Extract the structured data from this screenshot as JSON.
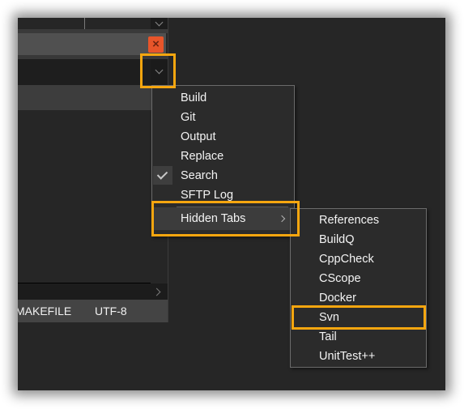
{
  "accent_color": "#f6a60f",
  "panel": {
    "close_icon": "×",
    "close_icon_name": "close-icon",
    "dropdown_icon_name": "chevron-down-icon",
    "status": {
      "file_type": "MAKEFILE",
      "encoding": "UTF-8"
    }
  },
  "menu": {
    "items": [
      {
        "label": "Build",
        "checked": false
      },
      {
        "label": "Git",
        "checked": false
      },
      {
        "label": "Output",
        "checked": false
      },
      {
        "label": "Replace",
        "checked": false
      },
      {
        "label": "Search",
        "checked": true
      },
      {
        "label": "SFTP Log",
        "checked": false
      },
      {
        "label": "Hidden Tabs",
        "submenu": true,
        "highlighted": true
      }
    ]
  },
  "submenu": {
    "items": [
      {
        "label": "References"
      },
      {
        "label": "BuildQ"
      },
      {
        "label": "CppCheck"
      },
      {
        "label": "CScope"
      },
      {
        "label": "Docker"
      },
      {
        "label": "Svn",
        "highlighted": true
      },
      {
        "label": "Tail"
      },
      {
        "label": "UnitTest++"
      }
    ]
  }
}
